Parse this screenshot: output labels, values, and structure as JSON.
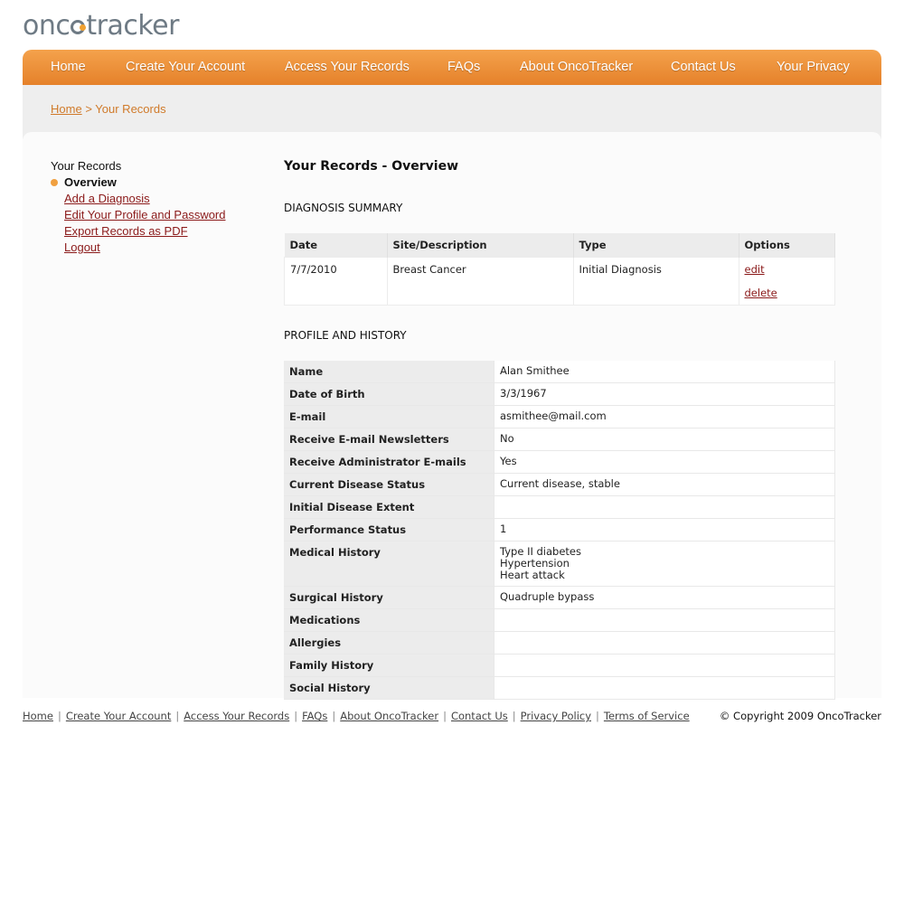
{
  "logo": {
    "text_a": "onc",
    "text_b": "tracker"
  },
  "nav": {
    "items": [
      "Home",
      "Create Your Account",
      "Access Your Records",
      "FAQs",
      "About OncoTracker",
      "Contact Us",
      "Your Privacy"
    ]
  },
  "breadcrumb": {
    "home": "Home",
    "separator": ">",
    "current": "Your Records"
  },
  "sidebar": {
    "title": "Your Records",
    "active": "Overview",
    "links": [
      "Add a Diagnosis",
      "Edit Your Profile and Password",
      "Export Records as PDF",
      "Logout"
    ]
  },
  "main": {
    "title": "Your Records - Overview",
    "diagnosis_heading": "DIAGNOSIS SUMMARY",
    "diagnosis_columns": [
      "Date",
      "Site/Description",
      "Type",
      "Options"
    ],
    "diagnosis_rows": [
      {
        "date": "7/7/2010",
        "site": "Breast Cancer",
        "type": "Initial Diagnosis",
        "edit": "edit",
        "delete": "delete"
      }
    ],
    "profile_heading": "PROFILE AND HISTORY",
    "profile": [
      {
        "label": "Name",
        "value": [
          "Alan Smithee"
        ]
      },
      {
        "label": "Date of Birth",
        "value": [
          "3/3/1967"
        ]
      },
      {
        "label": "E-mail",
        "value": [
          "asmithee@mail.com"
        ]
      },
      {
        "label": "Receive E-mail Newsletters",
        "value": [
          "No"
        ]
      },
      {
        "label": "Receive Administrator E-mails",
        "value": [
          "Yes"
        ]
      },
      {
        "label": "Current Disease Status",
        "value": [
          "Current disease, stable"
        ]
      },
      {
        "label": "Initial Disease Extent",
        "value": []
      },
      {
        "label": "Performance Status",
        "value": [
          "1"
        ]
      },
      {
        "label": "Medical History",
        "value": [
          "Type II diabetes",
          "Hypertension",
          "Heart attack"
        ]
      },
      {
        "label": "Surgical History",
        "value": [
          "Quadruple bypass"
        ]
      },
      {
        "label": "Medications",
        "value": []
      },
      {
        "label": "Allergies",
        "value": []
      },
      {
        "label": "Family History",
        "value": []
      },
      {
        "label": "Social History",
        "value": []
      }
    ]
  },
  "footer": {
    "links": [
      "Home",
      "Create Your Account",
      "Access Your Records",
      "FAQs",
      "About OncoTracker",
      "Contact Us",
      "Privacy Policy",
      "Terms of Service"
    ],
    "copyright": "© Copyright 2009 OncoTracker"
  },
  "colors": {
    "accent": "#f0a040",
    "nav": "#e98b33",
    "link": "#8b1a1a",
    "crumb": "#d07a2a"
  }
}
